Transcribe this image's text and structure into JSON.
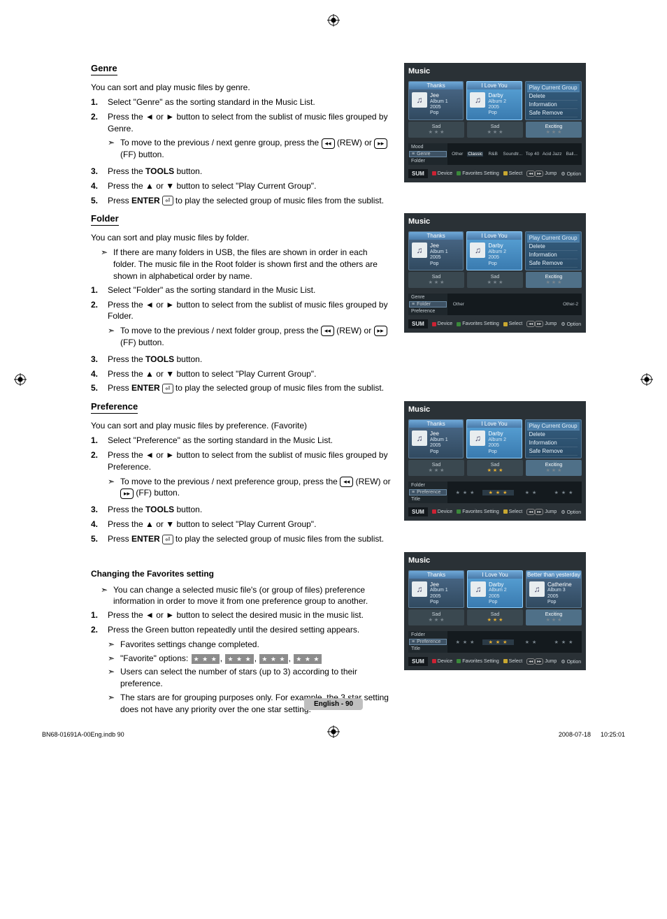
{
  "page_label": "English - 90",
  "doc_tag_left": "BN68-01691A-00Eng.indb   90",
  "doc_tag_right": "2008-07-18      10:25:01",
  "sections": {
    "genre": {
      "title": "Genre",
      "intro": "You can sort and play music files by genre.",
      "steps": [
        "Select \"Genre\" as the sorting standard in the Music List.",
        "Press the ◄ or ► button to select from the sublist of music files grouped by Genre.",
        "Press the TOOLS button.",
        "Press the ▲ or ▼ button to select \"Play Current Group\".",
        "Press ENTER ⏎ to play the selected group of music files from the sublist."
      ],
      "sub2": "To move to the previous / next genre group, press the ⏮ (REW) or ⏭ (FF) button."
    },
    "folder": {
      "title": "Folder",
      "intro": "You can sort and play music files by folder.",
      "intro_sub": "If there are many folders in USB, the files are shown in order in each folder. The music file in the Root folder is shown first and the others are shown in alphabetical order by name.",
      "steps": [
        "Select \"Folder\" as the sorting standard in the Music List.",
        "Press the ◄ or ► button to select from the sublist of music files grouped by Folder.",
        "Press the TOOLS button.",
        "Press the ▲ or ▼ button to select \"Play Current Group\".",
        "Press ENTER ⏎ to play the selected group of music files from the sublist."
      ],
      "sub2": "To move to the previous / next folder group, press the ⏮ (REW) or ⏭ (FF) button."
    },
    "preference": {
      "title": "Preference",
      "intro": "You can sort and play music files by preference. (Favorite)",
      "steps": [
        "Select \"Preference\" as the sorting standard in the Music List.",
        "Press the ◄ or ► button to select from the sublist of music files grouped by Preference.",
        "Press the TOOLS button.",
        "Press the ▲ or ▼ button to select \"Play Current Group\".",
        "Press ENTER ⏎ to play the selected group of music files from the sublist."
      ],
      "sub2": "To move to the previous / next preference group, press the ⏮ (REW) or ⏭ (FF) button."
    },
    "favorites": {
      "title": "Changing the Favorites setting",
      "intro_sub": "You can change a selected music file's (or group of files) preference information in order to move it from one preference group to another.",
      "steps": [
        "Press the ◄ or ► button to select the desired music in the music list.",
        "Press the Green button repeatedly until the desired setting appears."
      ],
      "subs2": [
        "Favorites settings change completed.",
        "\"Favorite\" options: ★☆☆, ★★☆, ★★★, ★★★",
        "Users can select the number of stars (up to 3) according to their preference.",
        "The stars are for grouping purposes only. For example, the 3 star setting does not have any priority over the one star setting."
      ]
    }
  },
  "shots": {
    "common": {
      "title": "Music",
      "tiles": [
        {
          "head": "Thanks",
          "name": "Jee",
          "album": "Album 1",
          "year": "2005",
          "genre": "Pop"
        },
        {
          "head": "I Love You",
          "name": "Darby",
          "album": "Album 2",
          "year": "2005",
          "genre": "Pop"
        }
      ],
      "menu": [
        "Play Current Group",
        "Delete",
        "Information",
        "Safe Remove"
      ],
      "third_card": {
        "head": "Better than yesterday",
        "name": "Catherine",
        "album": "Album 3",
        "year": "2005",
        "genre": "Pop"
      },
      "moods": [
        "Sad",
        "Sad",
        "Exciting"
      ],
      "sum": "SUM",
      "footer": [
        "Device",
        "Favorites Setting",
        "Select",
        "Jump",
        "Option"
      ]
    },
    "genre": {
      "cat_rows": [
        "Mood",
        "Genre",
        "Folder"
      ],
      "chips": [
        "Classic",
        "R&B",
        "Soundtr...",
        "Top 40",
        "Acid Jazz",
        "Ball..."
      ],
      "chip_other": "Other"
    },
    "folder": {
      "cat_rows": [
        "Genre",
        "Folder",
        "Preference"
      ],
      "chips_left": "Other",
      "chips_right": "Other-2"
    },
    "preference": {
      "cat_rows": [
        "Folder",
        "Preference",
        "Title"
      ],
      "stars": [
        "★ ★ ★",
        "★ ★ ★",
        "★ ★",
        "★ ★ ★"
      ]
    },
    "favorites": {
      "cat_rows": [
        "Folder",
        "Preference",
        "Title"
      ],
      "stars": [
        "★ ★ ★",
        "★ ★ ★",
        "★ ★",
        "★ ★ ★"
      ]
    }
  }
}
